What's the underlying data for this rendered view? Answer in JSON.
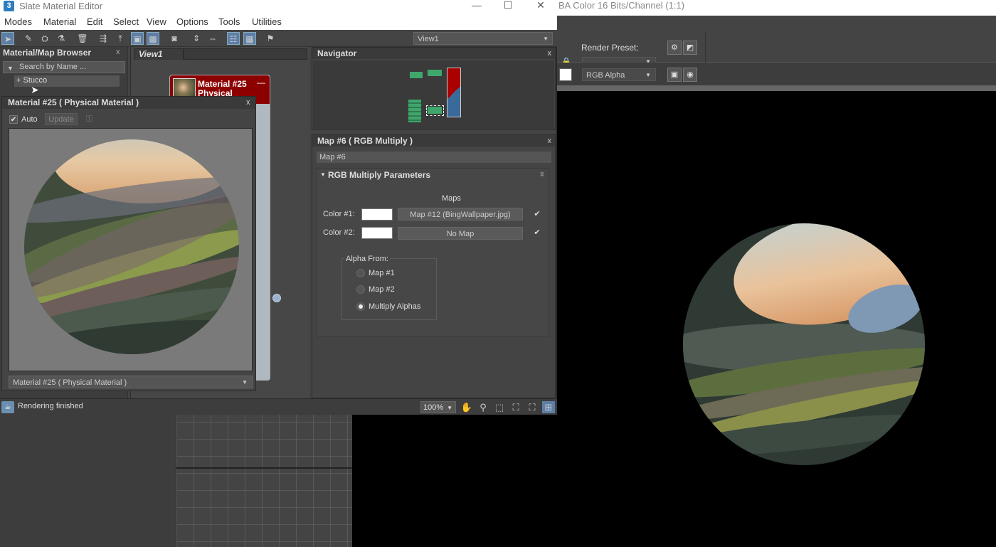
{
  "frame_buffer": {
    "title": "BA Color 16 Bits/Channel (1:1)",
    "render_preset_label": "Render Preset:",
    "render_preset_value": "",
    "channel_value": "RGB Alpha"
  },
  "editor": {
    "title": "Slate Material Editor",
    "app_icon": "3",
    "window_buttons": {
      "minimize": "—",
      "maximize": "☐",
      "close": "✕"
    },
    "menu": [
      "Modes",
      "Material",
      "Edit",
      "Select",
      "View",
      "Options",
      "Tools",
      "Utilities"
    ],
    "view_select": "View1"
  },
  "browser": {
    "title": "Material/Map Browser",
    "close": "x",
    "search_placeholder": "Search by Name ...",
    "item": "+ Stucco"
  },
  "view": {
    "tab": "View1",
    "node_title": "Material #25\nPhysical"
  },
  "navigator": {
    "title": "Navigator",
    "close": "x"
  },
  "map_panel": {
    "title": "Map #6  ( RGB Multiply )",
    "close": "x",
    "name_value": "Map #6",
    "rollout_title": "RGB Multiply Parameters",
    "maps_label": "Maps",
    "color1_label": "Color #1:",
    "color2_label": "Color #2:",
    "color1_map": "Map #12 (BingWallpaper.jpg)",
    "color2_map": "No Map",
    "color1_checked": "✔",
    "color2_checked": "✔",
    "alpha_from_label": "Alpha From:",
    "alpha_options": [
      "Map #1",
      "Map #2",
      "Multiply Alphas"
    ],
    "alpha_selected": "Multiply Alphas"
  },
  "preview": {
    "title": "Material #25  ( Physical Material )",
    "close": "x",
    "auto_label": "Auto",
    "auto_checked": "✔",
    "update_label": "Update",
    "select_value": "Material #25  ( Physical Material )"
  },
  "status": {
    "text": "Rendering finished",
    "zoom": "100%"
  },
  "colors": {
    "node_header": "#8d0000",
    "accent": "#5d7ea6",
    "nav_green": "#3fa66c"
  }
}
